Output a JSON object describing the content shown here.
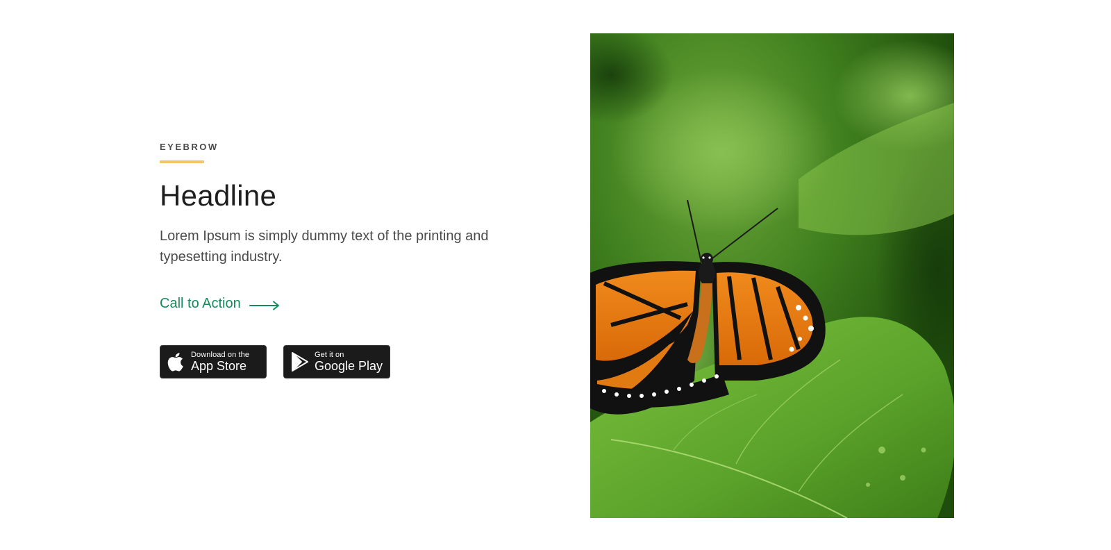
{
  "hero": {
    "eyebrow": "EYEBROW",
    "headline": "Headline",
    "body": "Lorem Ipsum is simply dummy text of the printing and typesetting industry.",
    "cta_label": "Call to Action",
    "cta_icon": "arrow-right-icon"
  },
  "stores": {
    "app_store": {
      "small": "Download on the",
      "large": "App Store",
      "icon": "apple-icon"
    },
    "google_play": {
      "small": "Get it on",
      "large": "Google Play",
      "icon": "google-play-icon"
    }
  },
  "image": {
    "subject": "monarch butterfly on green leaf"
  },
  "colors": {
    "accent_green": "#158a5a",
    "eyebrow_rule": "#f5c46a",
    "headline": "#1e1e1e",
    "body": "#4a4a4a",
    "badge_bg": "#1b1b1b"
  }
}
